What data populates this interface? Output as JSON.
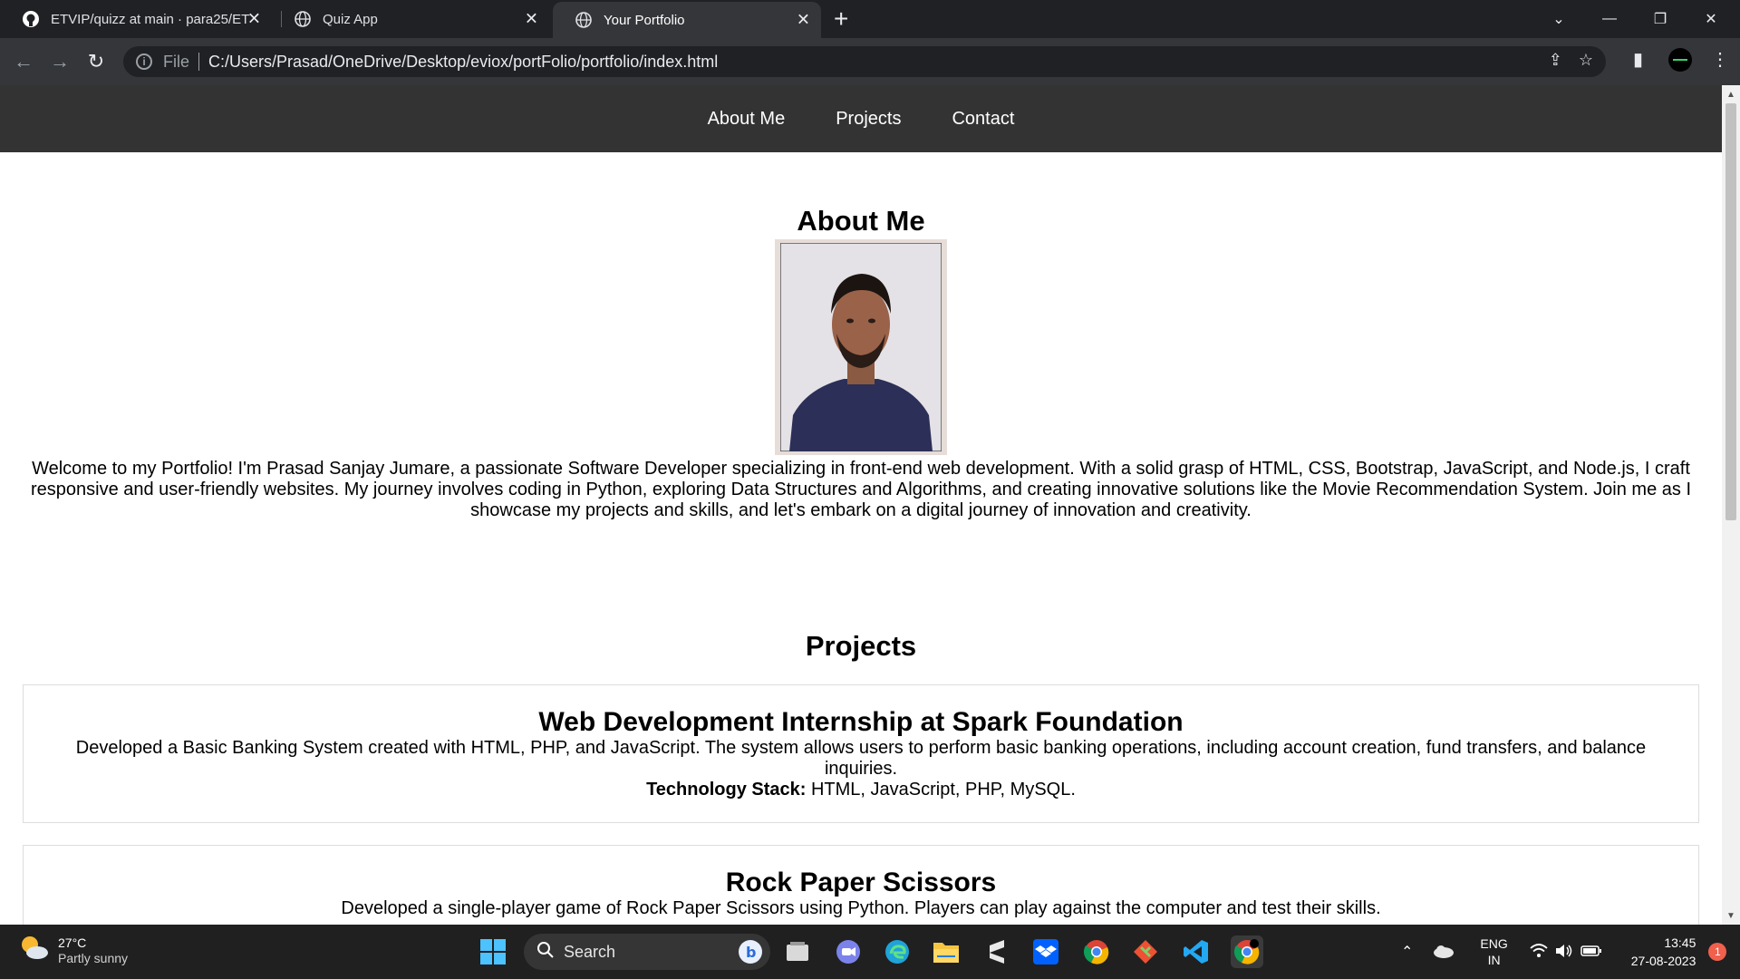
{
  "browser": {
    "tabs": [
      {
        "title": "ETVIP/quizz at main · para25/ETV",
        "icon": "github-icon"
      },
      {
        "title": "Quiz App",
        "icon": "globe-icon"
      },
      {
        "title": "Your Portfolio",
        "icon": "globe-icon",
        "active": true
      }
    ],
    "address_scheme": "File",
    "address_url": "C:/Users/Prasad/OneDrive/Desktop/eviox/portFolio/portfolio/index.html"
  },
  "site": {
    "nav": [
      "About Me",
      "Projects",
      "Contact"
    ],
    "about": {
      "heading": "About Me",
      "bio": "Welcome to my Portfolio! I'm Prasad Sanjay Jumare, a passionate Software Developer specializing in front-end web development. With a solid grasp of HTML, CSS, Bootstrap, JavaScript, and Node.js, I craft responsive and user-friendly websites. My journey involves coding in Python, exploring Data Structures and Algorithms, and creating innovative solutions like the Movie Recommendation System. Join me as I showcase my projects and skills, and let's embark on a digital journey of innovation and creativity."
    },
    "projects": {
      "heading": "Projects",
      "items": [
        {
          "title": "Web Development Internship at Spark Foundation",
          "description": "Developed a Basic Banking System created with HTML, PHP, and JavaScript. The system allows users to perform basic banking operations, including account creation, fund transfers, and balance inquiries.",
          "stack_label": "Technology Stack:",
          "stack": " HTML, JavaScript, PHP, MySQL."
        },
        {
          "title": "Rock Paper Scissors",
          "description": "Developed a single-player game of Rock Paper Scissors using Python. Players can play against the computer and test their skills."
        }
      ]
    }
  },
  "taskbar": {
    "weather_temp": "27°C",
    "weather_cond": "Partly sunny",
    "search_label": "Search",
    "lang_top": "ENG",
    "lang_bottom": "IN",
    "time": "13:45",
    "date": "27-08-2023",
    "notification_count": "1"
  },
  "colors": {
    "site_nav_bg": "#333333",
    "chrome_dark": "#202124",
    "chrome_toolbar": "#35363a",
    "taskbar_bg": "#202020"
  }
}
